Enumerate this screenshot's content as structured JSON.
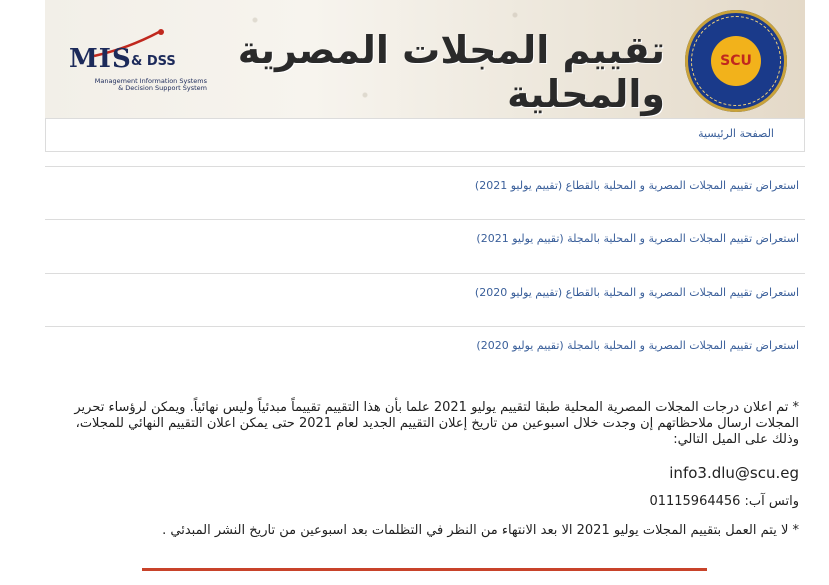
{
  "header": {
    "title": "تقييم المجلات المصرية والمحلية",
    "mis_logo_main": "MIS",
    "mis_logo_amp": "& DSS",
    "mis_logo_sub1": "Management Information Systems",
    "mis_logo_sub2": "& Decision Support System",
    "seal_text": "SCU",
    "seal_top": "المجلس الأعلى للجامعات",
    "seal_bottom": "SUPREME COUNCIL OF UNIVERSITIES"
  },
  "nav": {
    "home_label": "الصفحة الرئيسية"
  },
  "links": [
    {
      "label": "استعراض تقييم المجلات المصرية و المحلية بالقطاع (تقييم يوليو 2021)"
    },
    {
      "label": "استعراض تقييم المجلات المصرية و المحلية بالمجلة (تقييم يوليو 2021)"
    },
    {
      "label": "استعراض تقييم المجلات المصرية و المحلية بالقطاع (تقييم يوليو 2020)"
    },
    {
      "label": "استعراض تقييم المجلات المصرية و المحلية بالمجلة (تقييم يوليو 2020)"
    }
  ],
  "notes": {
    "note1": "* تم اعلان درجات المجلات المصرية المحلية طبقا لتقييم يوليو 2021 علما بأن هذا التقييم تقييماً مبدئياً وليس نهائياً. ويمكن لرؤساء تحرير المجلات ارسال ملاحظاتهم إن وجدت خلال اسبوعين من تاريخ إعلان التقييم الجديد لعام 2021 حتى يمكن اعلان التقييم النهائي للمجلات، وذلك على الميل التالي:",
    "email": "info3.dlu@scu.eg",
    "whatsapp": "واتس آب: 01115964456",
    "note2": "* لا يتم العمل بتقييم المجلات يوليو 2021 الا بعد الانتهاء من النظر في التظلمات بعد اسبوعين من تاريخ النشر المبدئي ."
  },
  "colors": {
    "link": "#3a5f9a",
    "accent_line": "#c8432a",
    "seal_blue": "#1a3a8a",
    "seal_gold": "#f2b21b"
  }
}
